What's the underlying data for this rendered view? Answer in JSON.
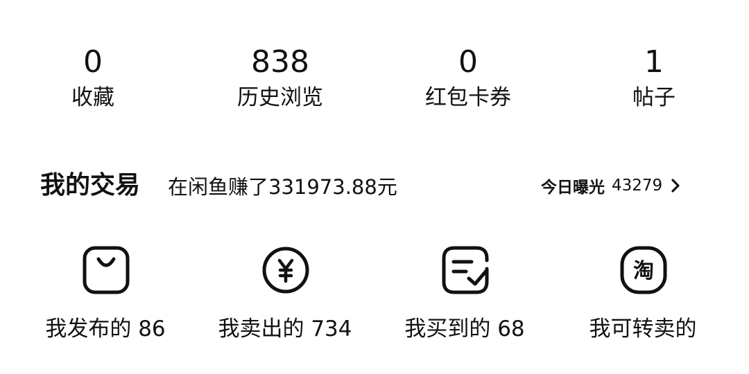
{
  "stats": [
    {
      "value": "0",
      "label": "收藏"
    },
    {
      "value": "838",
      "label": "历史浏览"
    },
    {
      "value": "0",
      "label": "红包卡券"
    },
    {
      "value": "1",
      "label": "帖子"
    }
  ],
  "trade": {
    "title": "我的交易",
    "earnings": "在闲鱼赚了331973.88元",
    "exposure_label": "今日曝光",
    "exposure_value": "43279",
    "chevron_icon": "chevron-right-icon"
  },
  "actions": [
    {
      "label": "我发布的 86",
      "icon": "shopping-bag-icon"
    },
    {
      "label": "我卖出的 734",
      "icon": "yen-coin-icon"
    },
    {
      "label": "我买到的 68",
      "icon": "order-check-icon"
    },
    {
      "label": "我可转卖的",
      "icon": "taobao-icon"
    }
  ],
  "colors": {
    "text": "#111111",
    "background": "#ffffff"
  }
}
